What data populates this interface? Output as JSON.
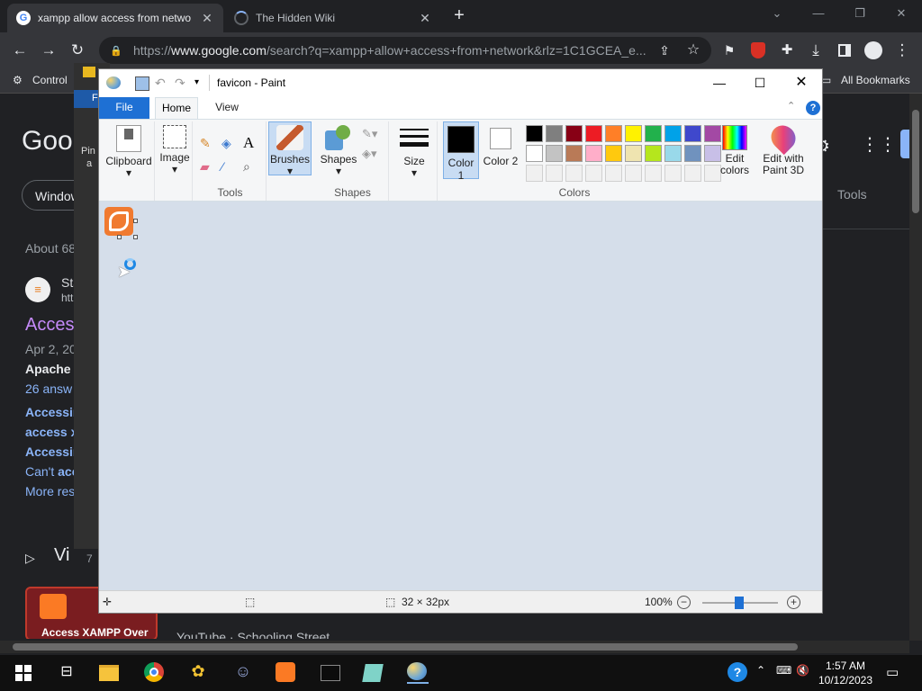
{
  "browser": {
    "tabs": [
      {
        "title": "xampp allow access from netwo",
        "active": true
      },
      {
        "title": "The Hidden Wiki",
        "active": false
      }
    ],
    "url_prefix": "https://",
    "url_host": "www.google.com",
    "url_path": "/search?q=xampp+allow+access+from+network&rlz=1C1GCEA_e...",
    "bookmarks": {
      "left": "Control",
      "right": "All Bookmarks"
    }
  },
  "google": {
    "logo": "Goog",
    "chip_windows": "Window",
    "tools": "Tools",
    "about": "About 68",
    "result_site": "Sta",
    "result_url": "htt",
    "result_title": "Acces",
    "result_date": "Apr 2, 20",
    "result_bold": "Apache",
    "answers": "26 answ",
    "links": [
      "Accessin",
      "access x",
      "Accessin"
    ],
    "cant": "Can't",
    "cant_bold": "acc",
    "more": "More res",
    "videos": "Vi",
    "video_num": "7",
    "video_thumb": "Access XAMPP Over",
    "video_source": "YouTube",
    "video_channel": "· Schooling Street",
    "pin": "Pin",
    "pin2": "a",
    "file_short": "F"
  },
  "paint": {
    "title": "favicon - Paint",
    "tabs": {
      "file": "File",
      "home": "Home",
      "view": "View"
    },
    "help": "?",
    "groups": {
      "clipboard": "Clipboard",
      "image": "Image",
      "tools": "Tools",
      "brushes": "Brushes",
      "shapes_btn": "Shapes",
      "shapes": "Shapes",
      "size": "Size",
      "color1": "Color 1",
      "color2": "Color 2",
      "edit_colors": "Edit colors",
      "edit_paint3d": "Edit with Paint 3D",
      "colors": "Colors"
    },
    "palette_row1": [
      "#000000",
      "#7f7f7f",
      "#880015",
      "#ed1c24",
      "#ff7f27",
      "#fff200",
      "#22b14c",
      "#00a2e8",
      "#3f48cc",
      "#a349a4"
    ],
    "palette_row2": [
      "#ffffff",
      "#c3c3c3",
      "#b97a57",
      "#ffaec9",
      "#ffc90e",
      "#efe4b0",
      "#b5e61d",
      "#99d9ea",
      "#7092be",
      "#c8bfe7"
    ],
    "status": {
      "size": "32 × 32px",
      "zoom": "100%"
    }
  },
  "taskbar": {
    "time": "1:57 AM",
    "date": "10/12/2023"
  }
}
